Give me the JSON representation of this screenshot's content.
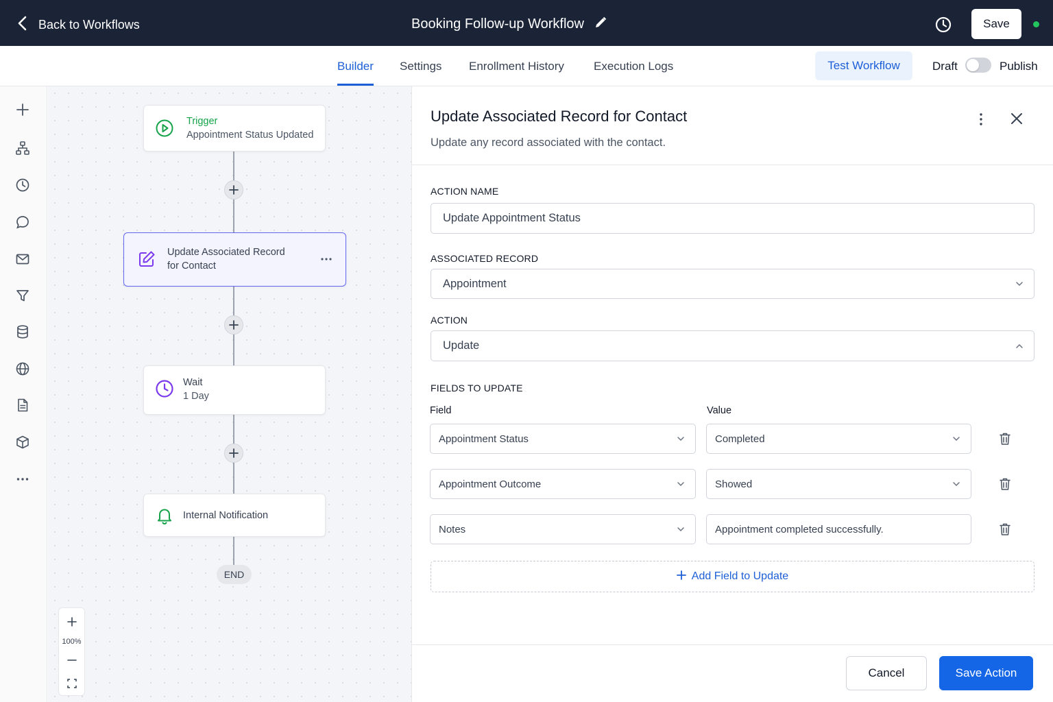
{
  "header": {
    "back_label": "Back to Workflows",
    "workflow_title": "Booking Follow-up Workflow",
    "save_label": "Save",
    "status_color": "#22c55e"
  },
  "tabs": [
    {
      "label": "Builder",
      "active": true
    },
    {
      "label": "Settings",
      "active": false
    },
    {
      "label": "Enrollment History",
      "active": false
    },
    {
      "label": "Execution Logs",
      "active": false
    }
  ],
  "toolbar": {
    "test_label": "Test Workflow",
    "draft_label": "Draft",
    "publish_label": "Publish",
    "published": false
  },
  "rail_icons": [
    "plus-icon",
    "hierarchy-icon",
    "clock-icon",
    "chat-icon",
    "mail-icon",
    "filter-icon",
    "database-icon",
    "globe-icon",
    "document-icon",
    "box-icon",
    "more-icon"
  ],
  "canvas": {
    "trigger": {
      "title": "Trigger",
      "subtitle": "Appointment Status Updated"
    },
    "action": {
      "title": "Update Associated Record",
      "title_line2": "for Contact"
    },
    "wait": {
      "title": "Wait",
      "subtitle": "1 Day"
    },
    "notification": {
      "title": "Internal Notification"
    },
    "end_label": "END",
    "zoom_level": "100%"
  },
  "panel": {
    "title": "Update Associated Record for Contact",
    "subtitle": "Update any record associated with the contact.",
    "action_name_label": "ACTION NAME",
    "action_name_value": "Update Appointment Status",
    "associated_record_label": "ASSOCIATED RECORD",
    "associated_record_value": "Appointment",
    "action_label": "ACTION",
    "action_value": "Update",
    "fields_label": "FIELDS TO UPDATE",
    "field_col_label": "Field",
    "value_col_label": "Value",
    "rows": [
      {
        "field": "Appointment Status",
        "value": "Completed"
      },
      {
        "field": "Appointment Outcome",
        "value": "Showed"
      },
      {
        "field": "Notes",
        "value": "Appointment completed successfully."
      }
    ],
    "add_field_label": "Add Field to Update",
    "cancel_label": "Cancel",
    "save_action_label": "Save Action"
  },
  "colors": {
    "accent": "#1d5fd6",
    "header_bg": "#1a2436",
    "trigger_green": "#16a34a",
    "selected_border": "#6366f1",
    "wait_purple": "#7c3aed"
  }
}
